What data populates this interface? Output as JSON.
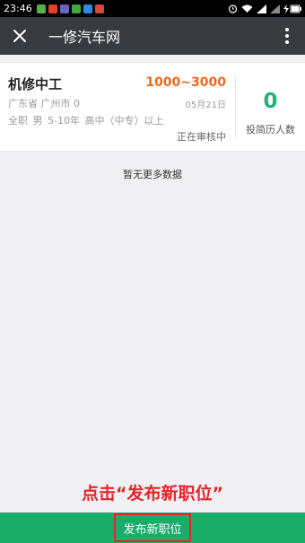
{
  "status_bar": {
    "time": "23:46",
    "notification_icons": [
      "app-icon",
      "weibo-icon",
      "app-icon",
      "wechat-icon",
      "qq-icon",
      "app-icon"
    ],
    "notification_colors": [
      "#53b146",
      "#e5422c",
      "#6a64c8",
      "#3dab3d",
      "#2e8ae0",
      "#d94a3a"
    ]
  },
  "app_bar": {
    "title": "一修汽车网"
  },
  "job": {
    "title": "机修中工",
    "salary": "1000~3000",
    "location": "广东省 广州市  0",
    "date": "05月21日",
    "requirements": "全职   男   5-10年   高中（中专）以上",
    "status": "正在审核中",
    "resume_count": "0",
    "resume_count_label": "投简历人数"
  },
  "list_end_text": "暂无更多数据",
  "hint_text": "点击“发布新职位”",
  "publish_button_label": "发布新职位",
  "colors": {
    "app_bar": "#393a3f",
    "salary": "#ec6a1e",
    "count": "#1fb47a",
    "bottom_bar": "#1aad6a",
    "hint": "#e8232a"
  }
}
